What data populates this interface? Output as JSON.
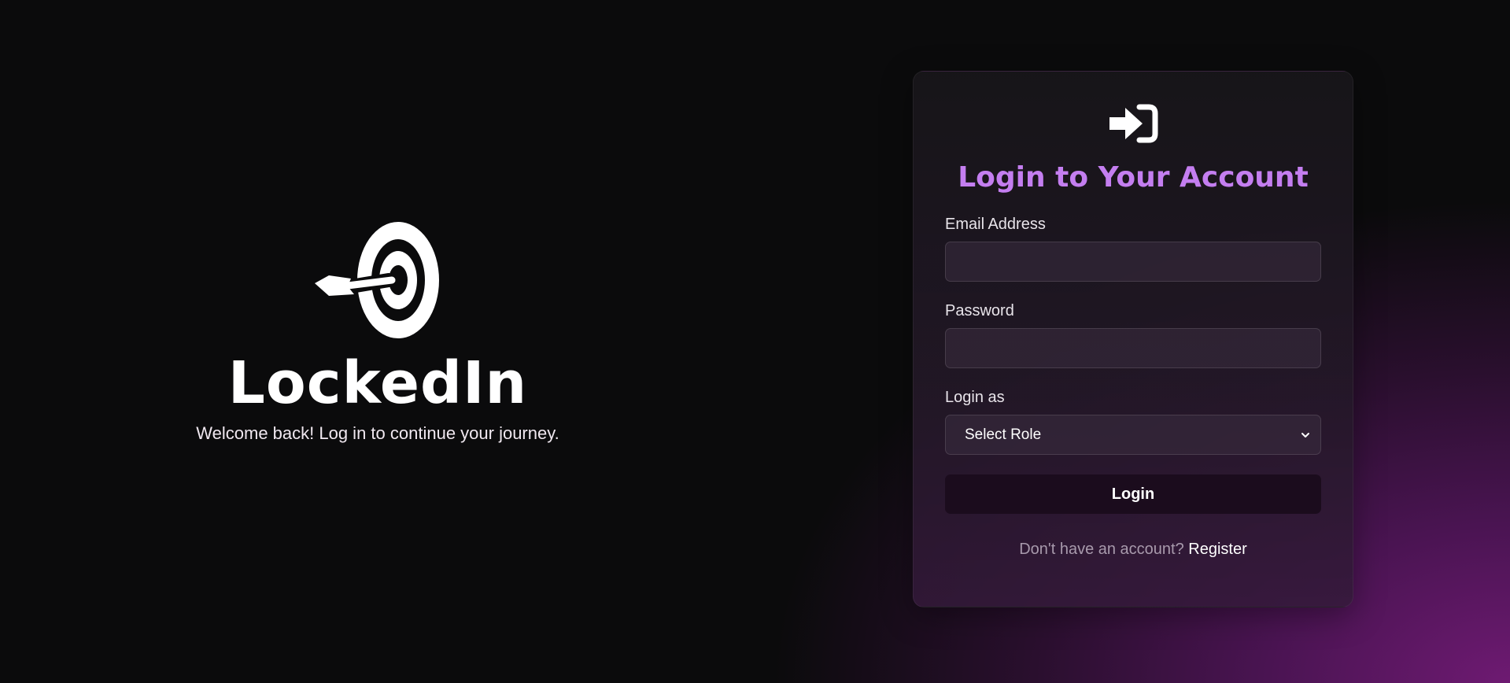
{
  "brand": {
    "logo_icon": "target-arrow-icon",
    "name": "LockedIn",
    "tagline": "Welcome back! Log in to continue your journey."
  },
  "login_card": {
    "icon": "sign-in-icon",
    "title": "Login to Your Account",
    "fields": {
      "email": {
        "label": "Email Address",
        "value": "",
        "placeholder": ""
      },
      "password": {
        "label": "Password",
        "value": "",
        "placeholder": ""
      },
      "role": {
        "label": "Login as",
        "selected": "Select Role"
      }
    },
    "submit_label": "Login",
    "register_prompt": "Don't have an account?",
    "register_link": "Register"
  },
  "colors": {
    "accent": "#c47ef0",
    "background": "#0b0b0c",
    "gradient_purple": "#6e1a72",
    "button_bg": "#1b0c1d"
  }
}
